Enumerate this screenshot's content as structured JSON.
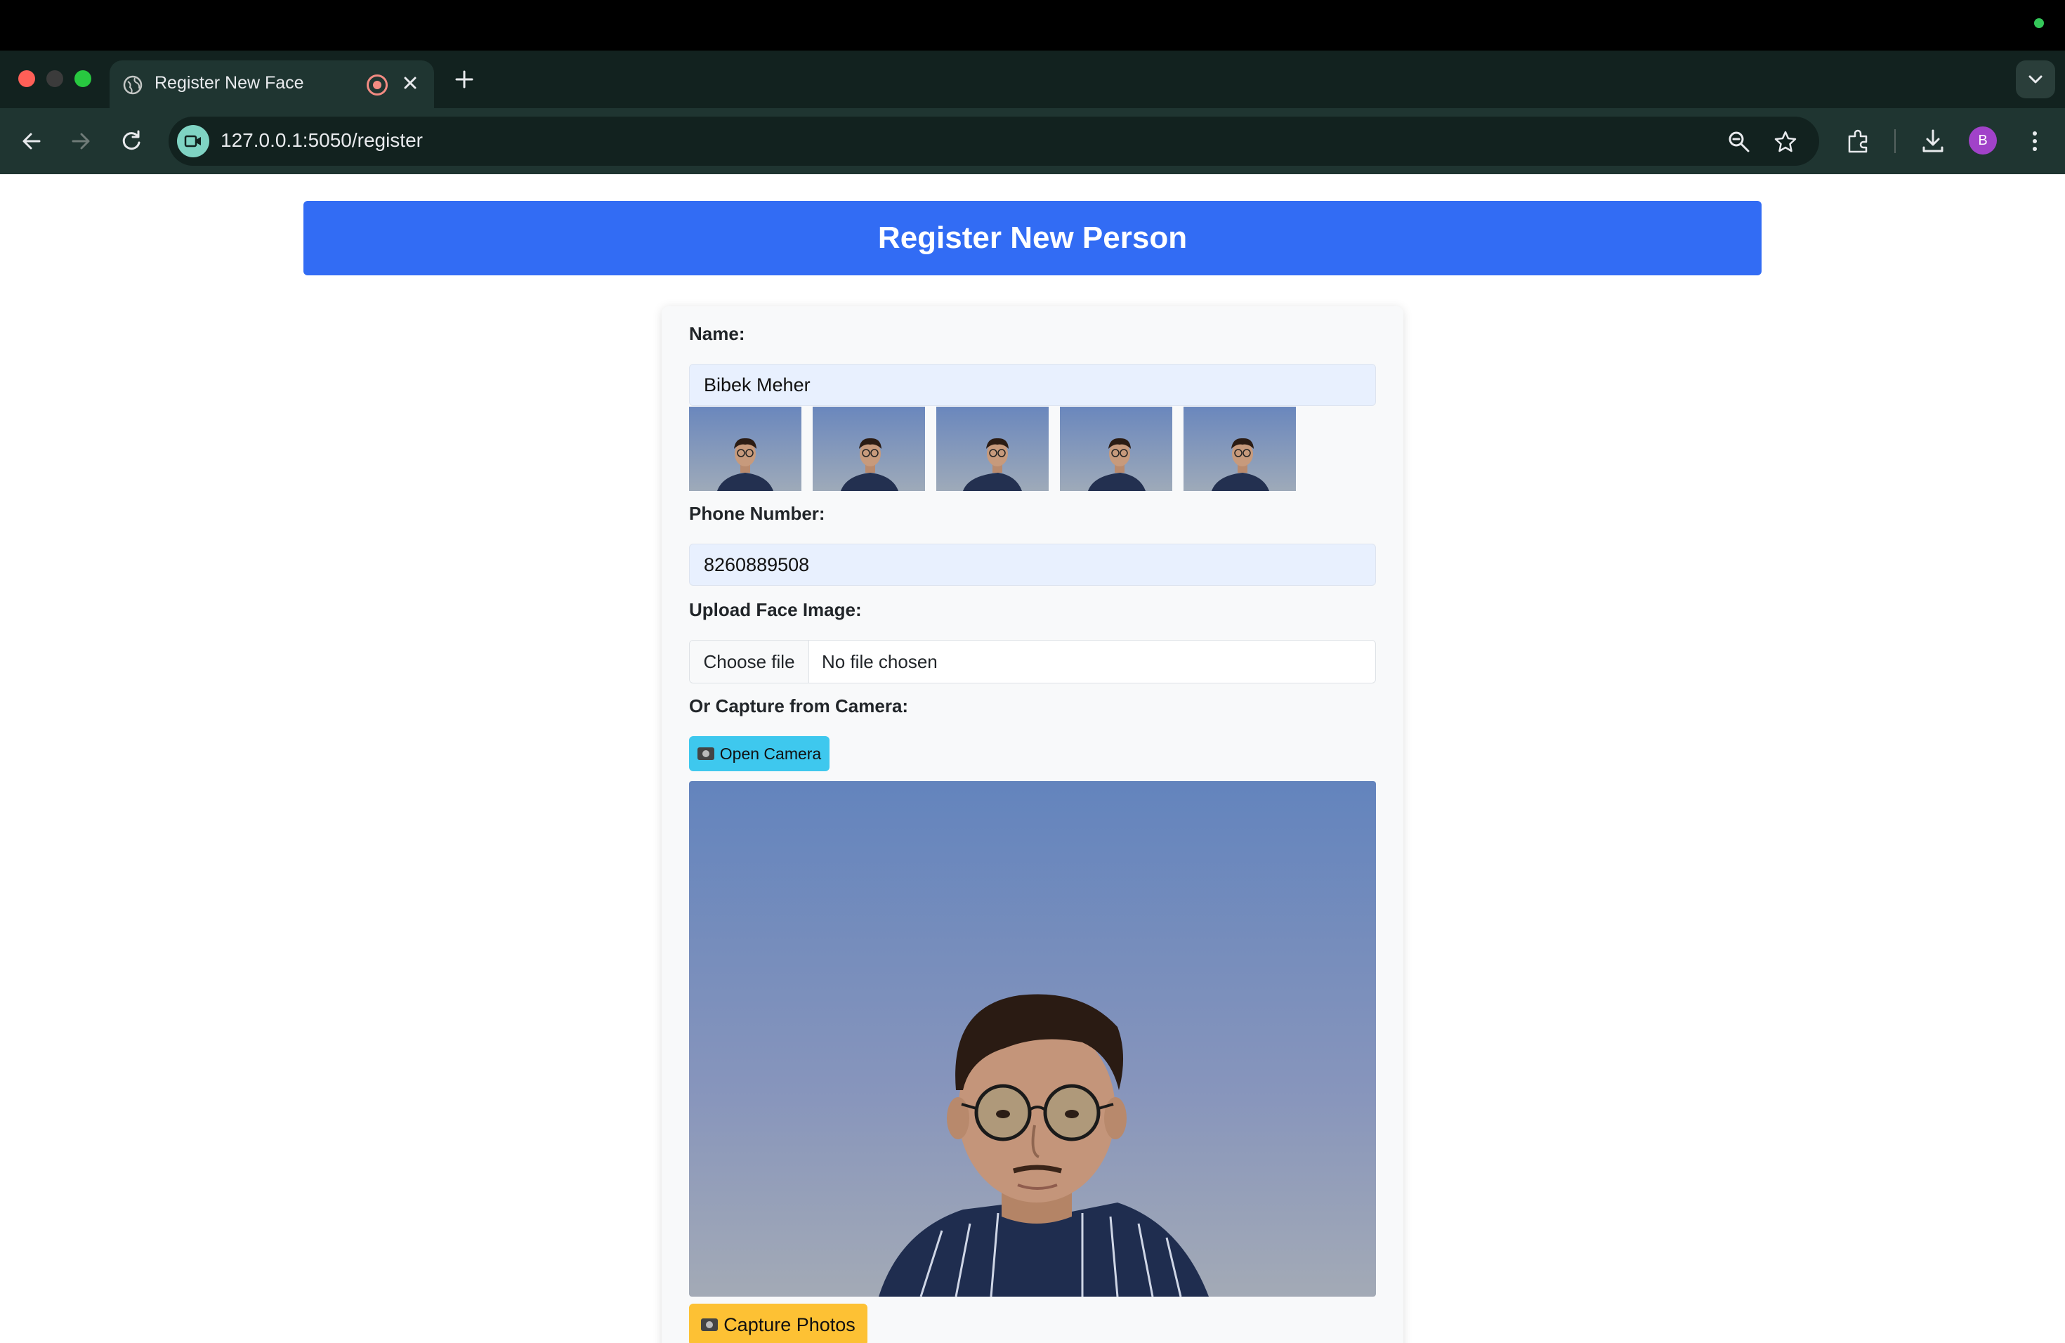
{
  "browser": {
    "tab_title": "Register New Face",
    "url": "127.0.0.1:5050/register",
    "avatar_initial": "B"
  },
  "page": {
    "header_title": "Register New Person",
    "form": {
      "name_label": "Name:",
      "name_value": "Bibek Meher",
      "captured_thumbnail_count": 5,
      "phone_label": "Phone Number:",
      "phone_value": "8260889508",
      "upload_label": "Upload Face Image:",
      "choose_file_label": "Choose file",
      "file_status": "No file chosen",
      "camera_label": "Or Capture from Camera:",
      "open_camera_label": "Open Camera",
      "capture_photos_label": "Capture Photos"
    }
  },
  "colors": {
    "header_blue": "#326cf4",
    "open_camera_cyan": "#3ec8ee",
    "capture_yellow": "#fdc134",
    "input_fill": "#e8f0fe"
  },
  "icons": [
    "globe-icon",
    "recording-icon",
    "close-icon",
    "plus-icon",
    "chevron-down-icon",
    "back-icon",
    "forward-icon",
    "reload-icon",
    "camera-site-icon",
    "zoom-icon",
    "star-icon",
    "extensions-icon",
    "download-icon",
    "more-icon",
    "camera-emoji-icon"
  ]
}
